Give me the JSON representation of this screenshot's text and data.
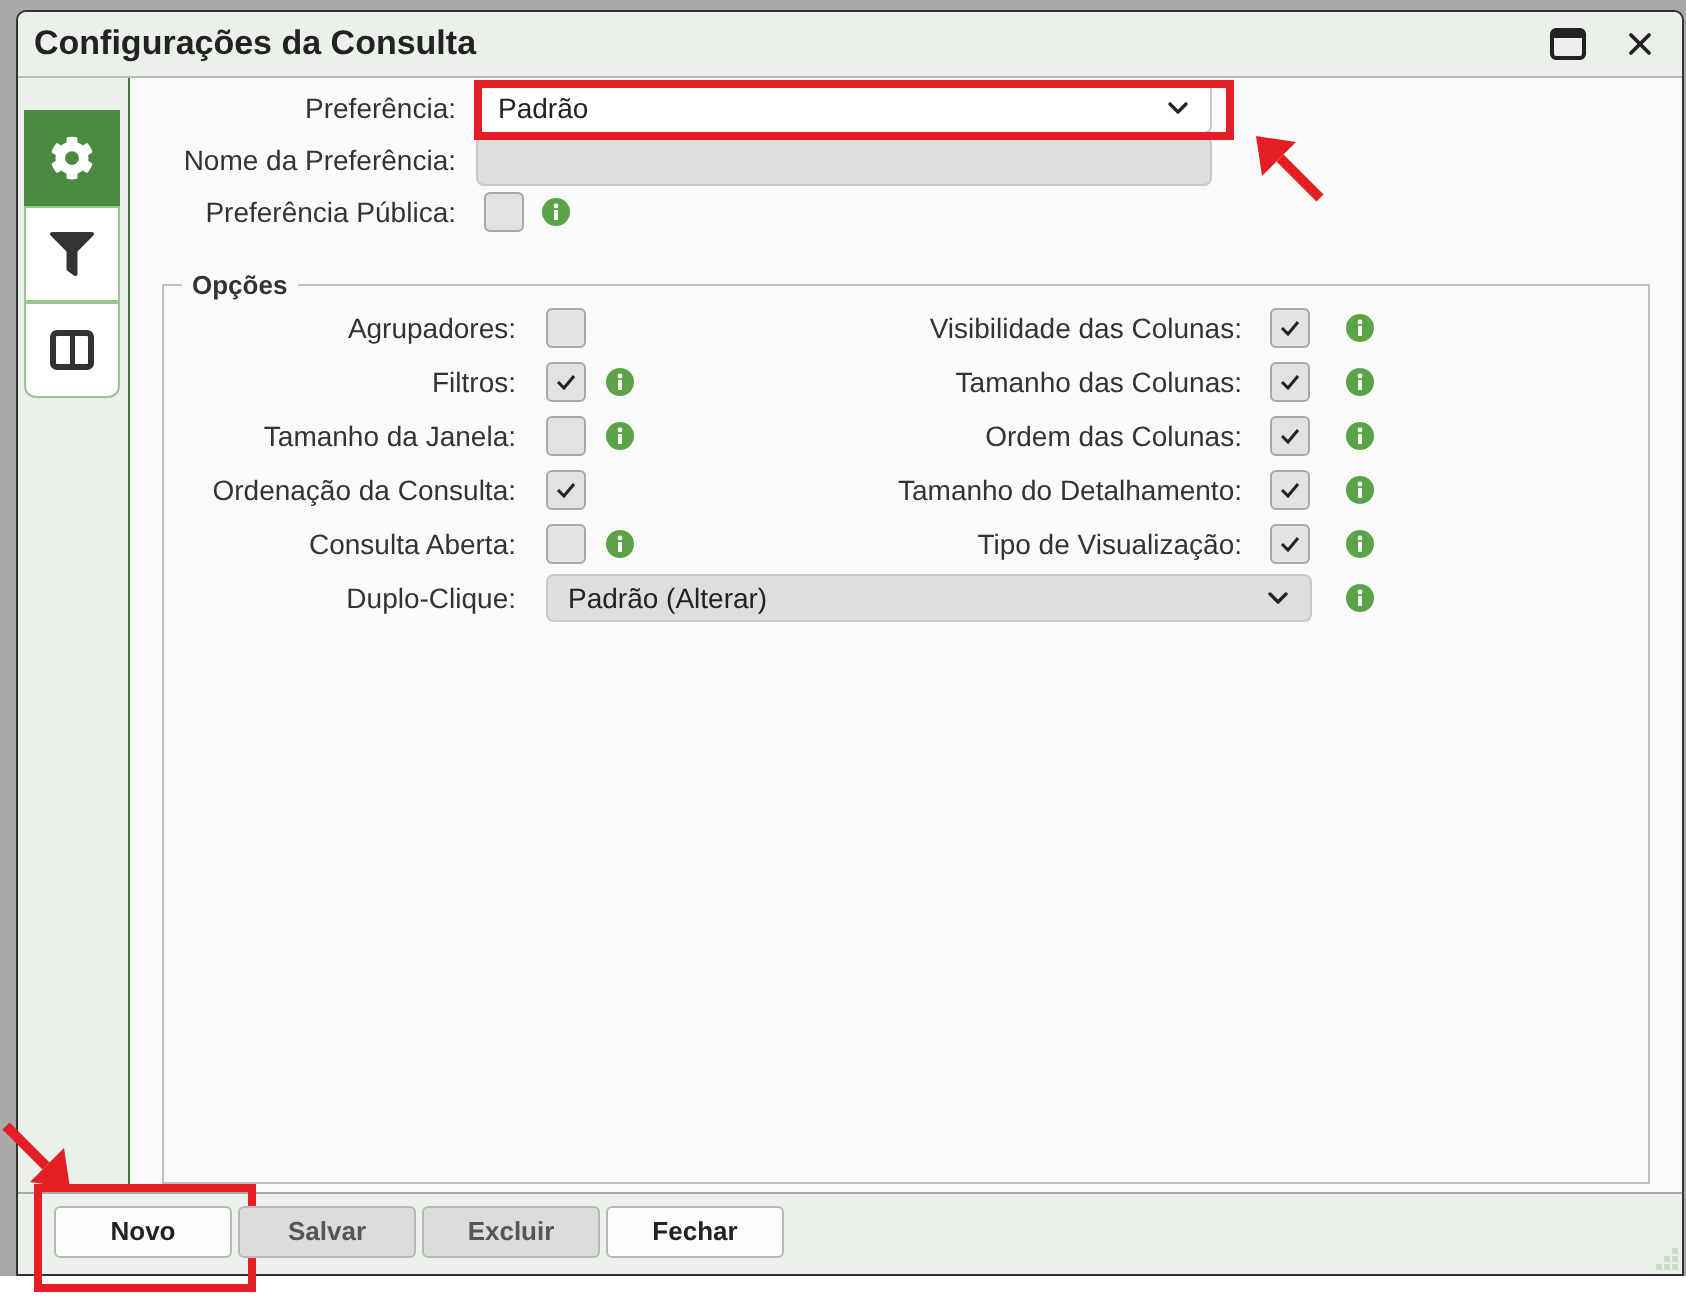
{
  "window": {
    "title": "Configurações da Consulta"
  },
  "sidebar": {
    "tabs": [
      {
        "kind": "settings",
        "selected": true
      },
      {
        "kind": "filter",
        "selected": false
      },
      {
        "kind": "layout",
        "selected": false
      }
    ]
  },
  "preference": {
    "label": "Preferência:",
    "value": "Padrão",
    "highlighted": true
  },
  "preference_name": {
    "label": "Nome da Preferência:",
    "disabled": true
  },
  "public_preference": {
    "label": "Preferência Pública:",
    "checked": false,
    "info": true
  },
  "options": {
    "title": "Opções",
    "left": [
      {
        "label": "Agrupadores:",
        "checked": false,
        "info": false
      },
      {
        "label": "Filtros:",
        "checked": true,
        "info": true
      },
      {
        "label": "Tamanho da Janela:",
        "checked": false,
        "info": true
      },
      {
        "label": "Ordenação da Consulta:",
        "checked": true,
        "info": false
      },
      {
        "label": "Consulta Aberta:",
        "checked": false,
        "info": true
      }
    ],
    "right": [
      {
        "label": "Visibilidade das Colunas:",
        "checked": true,
        "info": true
      },
      {
        "label": "Tamanho das Colunas:",
        "checked": true,
        "info": true
      },
      {
        "label": "Ordem das Colunas:",
        "checked": true,
        "info": true
      },
      {
        "label": "Tamanho do Detalhamento:",
        "checked": true,
        "info": true
      },
      {
        "label": "Tipo de Visualização:",
        "checked": true,
        "info": true
      }
    ],
    "double_click": {
      "label": "Duplo-Clique:",
      "value": "Padrão (Alterar)",
      "info": true
    }
  },
  "buttons": [
    {
      "label": "Novo",
      "disabled": false,
      "highlighted": true
    },
    {
      "label": "Salvar",
      "disabled": true,
      "highlighted": false
    },
    {
      "label": "Excluir",
      "disabled": true,
      "highlighted": false
    },
    {
      "label": "Fechar",
      "disabled": false,
      "highlighted": false
    }
  ]
}
